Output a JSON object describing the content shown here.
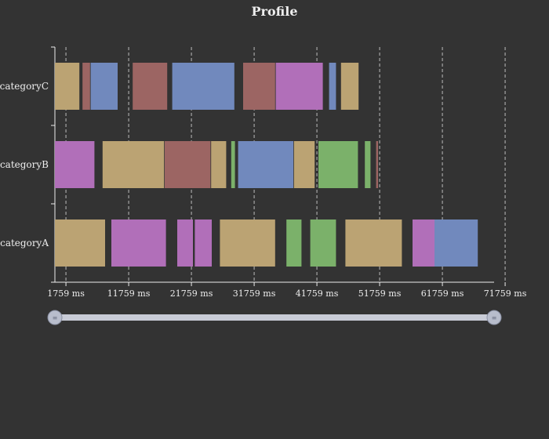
{
  "chart_data": {
    "type": "bar",
    "title": "Profile",
    "xlabel": "",
    "ylabel": "",
    "categories": [
      "categoryA",
      "categoryB",
      "categoryC"
    ],
    "x_range": [
      0,
      70000
    ],
    "x_unit": "ms",
    "x_ticks": [
      1759,
      11759,
      21759,
      31759,
      41759,
      51759,
      61759,
      71759
    ],
    "x_tick_labels": [
      "1759 ms",
      "11759 ms",
      "21759 ms",
      "31759 ms",
      "41759 ms",
      "51759 ms",
      "61759 ms",
      "71759 ms"
    ],
    "grid": true,
    "colors": {
      "tan": "#bba373",
      "red": "#9c6563",
      "blue": "#7189bd",
      "purple": "#b16fb9",
      "green": "#7bb16a"
    },
    "segments": {
      "categoryC": [
        {
          "start": 0,
          "end": 3900,
          "color": "tan"
        },
        {
          "start": 4400,
          "end": 5600,
          "color": "red"
        },
        {
          "start": 5700,
          "end": 10000,
          "color": "blue"
        },
        {
          "start": 12400,
          "end": 17900,
          "color": "red"
        },
        {
          "start": 18700,
          "end": 28600,
          "color": "blue"
        },
        {
          "start": 30000,
          "end": 35100,
          "color": "red"
        },
        {
          "start": 35200,
          "end": 42700,
          "color": "purple"
        },
        {
          "start": 43700,
          "end": 44800,
          "color": "blue"
        },
        {
          "start": 45600,
          "end": 48400,
          "color": "tan"
        }
      ],
      "categoryB": [
        {
          "start": 0,
          "end": 6300,
          "color": "purple"
        },
        {
          "start": 7600,
          "end": 17400,
          "color": "tan"
        },
        {
          "start": 17500,
          "end": 24800,
          "color": "red"
        },
        {
          "start": 24900,
          "end": 27300,
          "color": "tan"
        },
        {
          "start": 28100,
          "end": 28700,
          "color": "green"
        },
        {
          "start": 29200,
          "end": 38000,
          "color": "blue"
        },
        {
          "start": 38100,
          "end": 41400,
          "color": "tan"
        },
        {
          "start": 42000,
          "end": 48300,
          "color": "green"
        },
        {
          "start": 49400,
          "end": 50300,
          "color": "green"
        },
        {
          "start": 51200,
          "end": 51500,
          "color": "red"
        }
      ],
      "categoryA": [
        {
          "start": 0,
          "end": 8000,
          "color": "tan"
        },
        {
          "start": 9000,
          "end": 17700,
          "color": "purple"
        },
        {
          "start": 19500,
          "end": 22000,
          "color": "purple"
        },
        {
          "start": 22300,
          "end": 25000,
          "color": "purple"
        },
        {
          "start": 26300,
          "end": 35100,
          "color": "tan"
        },
        {
          "start": 36900,
          "end": 39300,
          "color": "green"
        },
        {
          "start": 40700,
          "end": 44800,
          "color": "green"
        },
        {
          "start": 46300,
          "end": 55300,
          "color": "tan"
        },
        {
          "start": 57000,
          "end": 60500,
          "color": "purple"
        },
        {
          "start": 60500,
          "end": 67400,
          "color": "blue"
        }
      ]
    },
    "brush_range": [
      0,
      70000
    ]
  }
}
